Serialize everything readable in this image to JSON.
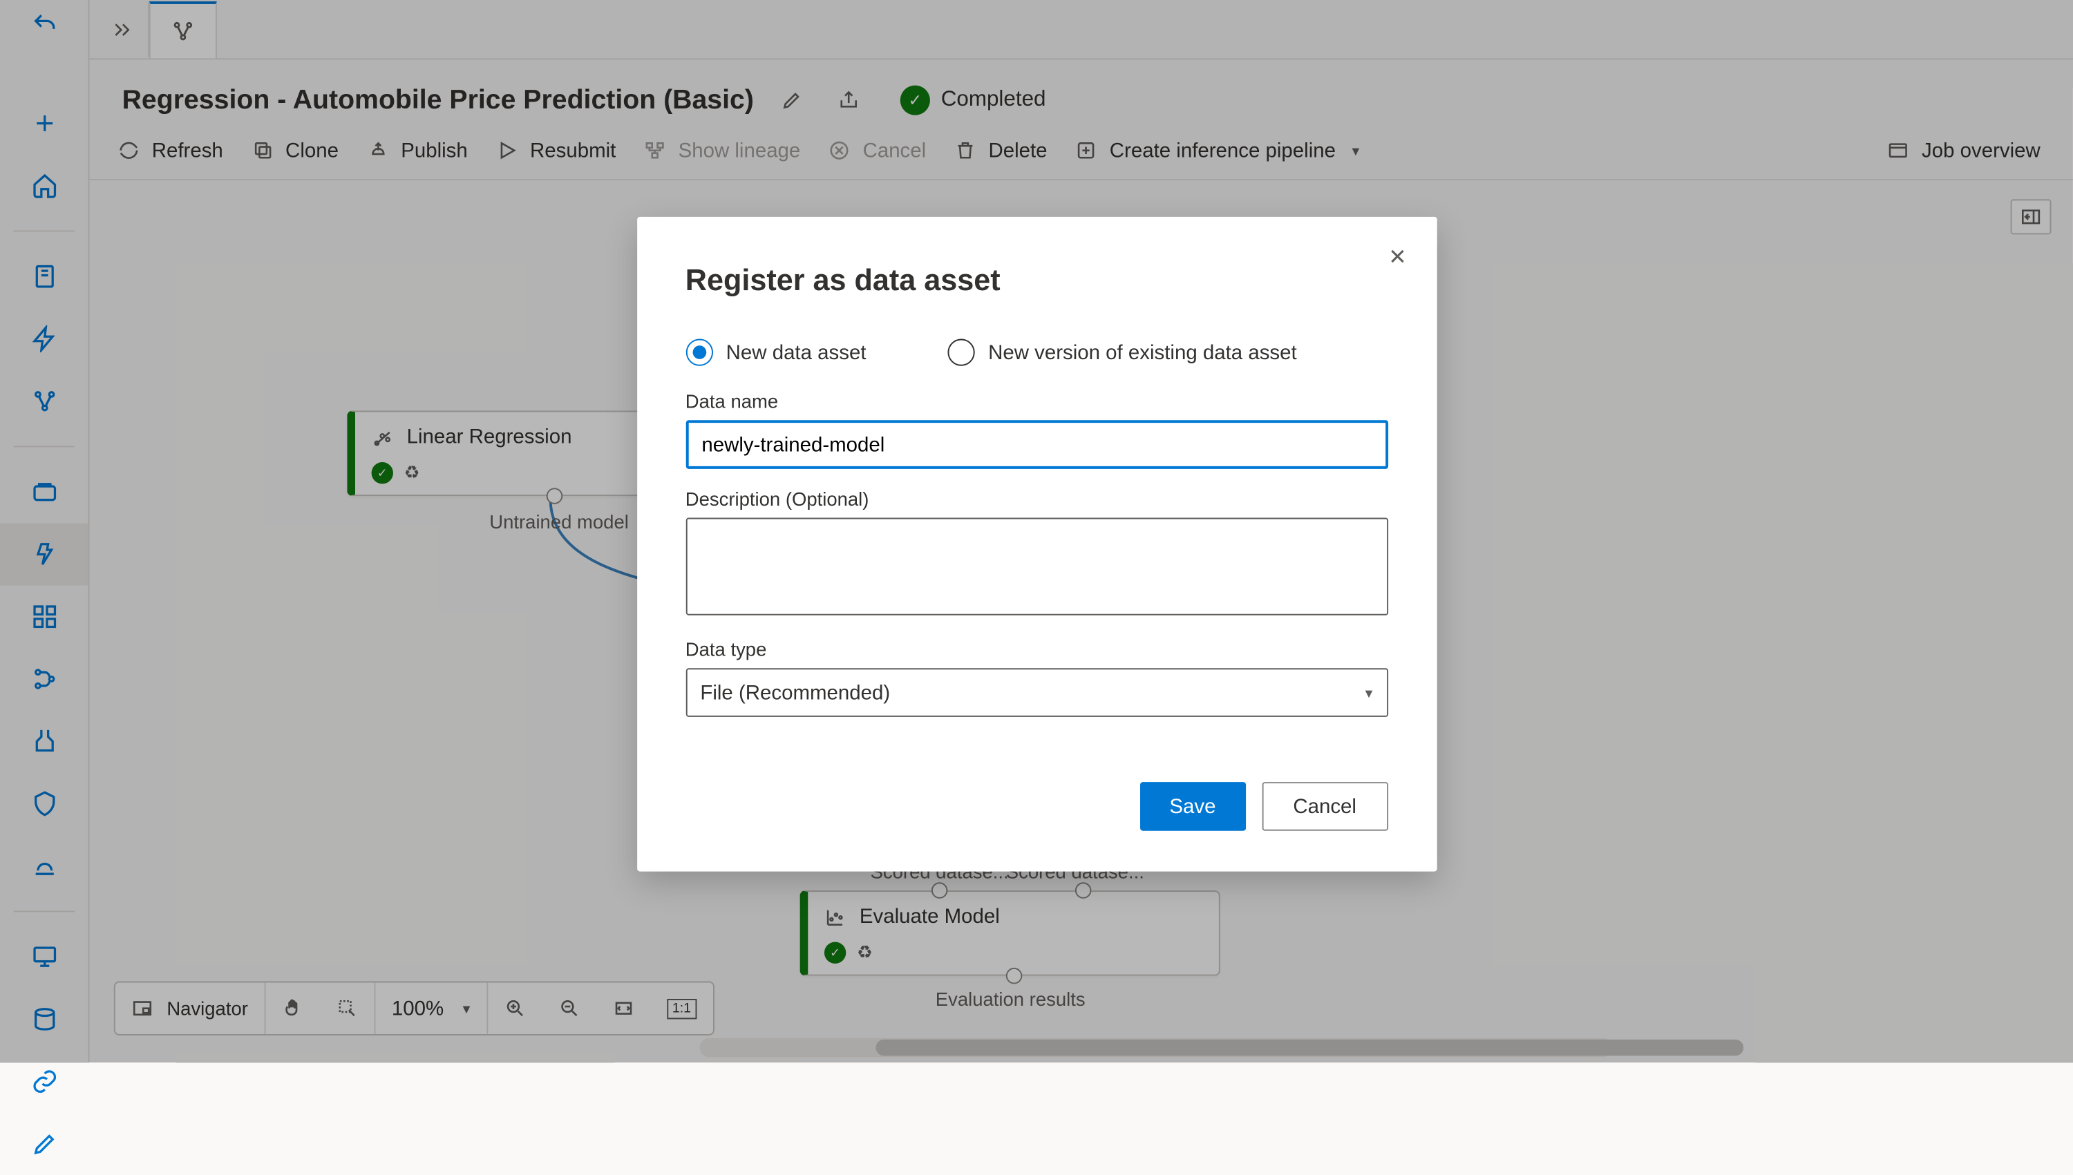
{
  "header": {
    "title": "Regression - Automobile Price Prediction (Basic)",
    "status": "Completed"
  },
  "toolbar": {
    "refresh": "Refresh",
    "clone": "Clone",
    "publish": "Publish",
    "resubmit": "Resubmit",
    "show_lineage": "Show lineage",
    "cancel": "Cancel",
    "delete": "Delete",
    "create_inference": "Create inference pipeline",
    "job_overview": "Job overview"
  },
  "canvas": {
    "nodes": {
      "linear_regression": {
        "label": "Linear Regression",
        "out_label": "Untrained model"
      },
      "evaluate_model": {
        "label": "Evaluate Model",
        "out_label": "Evaluation results"
      }
    },
    "labels": {
      "scored_dataset": "Scored dataset",
      "scored_dataset_left": "Scored datase...",
      "scored_dataset_right": "Scored datase..."
    }
  },
  "navigator": {
    "label": "Navigator",
    "zoom": "100%"
  },
  "modal": {
    "title": "Register as data asset",
    "radio_new": "New data asset",
    "radio_version": "New version of existing data asset",
    "name_label": "Data name",
    "name_value": "newly-trained-model",
    "desc_label": "Description (Optional)",
    "type_label": "Data type",
    "type_value": "File (Recommended)",
    "save": "Save",
    "cancel": "Cancel"
  }
}
